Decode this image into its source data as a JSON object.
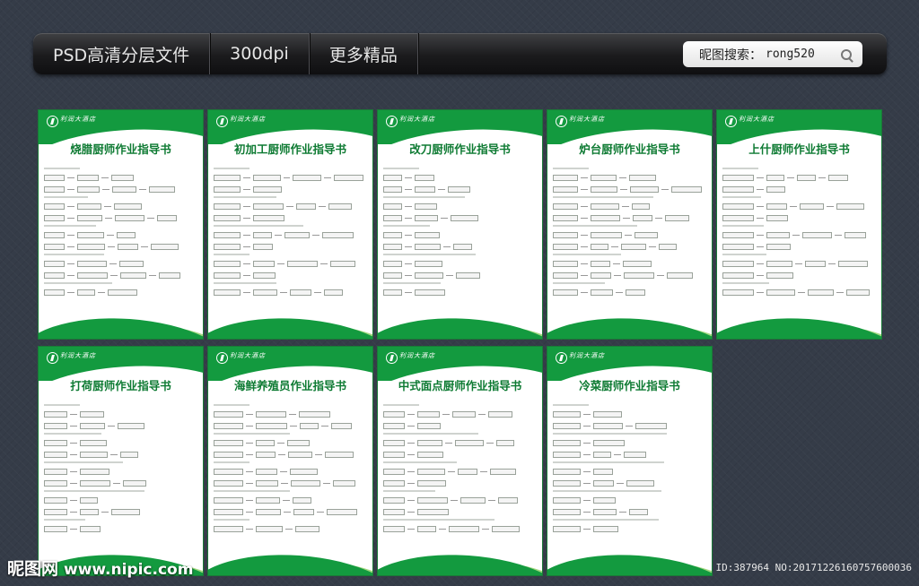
{
  "topbar": {
    "items": [
      "PSD高清分层文件",
      "300dpi",
      "更多精品"
    ],
    "search_label": "昵图搜索：",
    "search_value": "rong520"
  },
  "cards": [
    {
      "hotel": "利润大酒店",
      "title": "烧腊厨师作业指导书"
    },
    {
      "hotel": "利润大酒店",
      "title": "初加工厨师作业指导书"
    },
    {
      "hotel": "利润大酒店",
      "title": "改刀厨师作业指导书"
    },
    {
      "hotel": "利润大酒店",
      "title": "炉台厨师作业指导书"
    },
    {
      "hotel": "利润大酒店",
      "title": "上什厨师作业指导书"
    },
    {
      "hotel": "利润大酒店",
      "title": "打荷厨师作业指导书"
    },
    {
      "hotel": "利润大酒店",
      "title": "海鲜养殖员作业指导书"
    },
    {
      "hotel": "利润大酒店",
      "title": "中式面点厨师作业指导书"
    },
    {
      "hotel": "利润大酒店",
      "title": "冷菜厨师作业指导书"
    }
  ],
  "watermark": {
    "logo": "昵图网",
    "url": "www.nipic.com",
    "id": "ID:387964 NO:20171226160757600036"
  },
  "colors": {
    "accent": "#139a3f",
    "title": "#0d7a32",
    "background": "#353c48"
  }
}
